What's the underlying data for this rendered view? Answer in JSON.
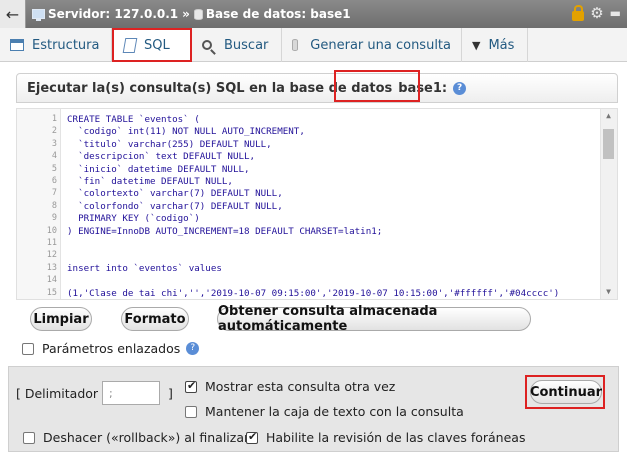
{
  "titlebar": {
    "back": "←",
    "server_label": "Servidor: 127.0.0.1",
    "separator": "»",
    "db_label": "Base de datos: base1"
  },
  "tabs": [
    {
      "label": "Estructura"
    },
    {
      "label": "SQL"
    },
    {
      "label": "Buscar"
    },
    {
      "label": "Generar una consulta"
    },
    {
      "label": "Más"
    }
  ],
  "panel": {
    "heading": "Ejecutar la(s) consulta(s) SQL en la base de datos",
    "database": "base1:",
    "help": "?"
  },
  "editor": {
    "lines": [
      {
        "n": "1",
        "text": "CREATE TABLE `eventos` ("
      },
      {
        "n": "2",
        "text": "  `codigo` int(11) NOT NULL AUTO_INCREMENT,"
      },
      {
        "n": "3",
        "text": "  `titulo` varchar(255) DEFAULT NULL,"
      },
      {
        "n": "4",
        "text": "  `descripcion` text DEFAULT NULL,"
      },
      {
        "n": "5",
        "text": "  `inicio` datetime DEFAULT NULL,"
      },
      {
        "n": "6",
        "text": "  `fin` datetime DEFAULT NULL,"
      },
      {
        "n": "7",
        "text": "  `colortexto` varchar(7) DEFAULT NULL,"
      },
      {
        "n": "8",
        "text": "  `colorfondo` varchar(7) DEFAULT NULL,"
      },
      {
        "n": "9",
        "text": "  PRIMARY KEY (`codigo`)"
      },
      {
        "n": "10",
        "text": ") ENGINE=InnoDB AUTO_INCREMENT=18 DEFAULT CHARSET=latin1;"
      },
      {
        "n": "11",
        "text": ""
      },
      {
        "n": "12",
        "text": ""
      },
      {
        "n": "13",
        "text": "insert into `eventos` values"
      },
      {
        "n": "14",
        "text": ""
      },
      {
        "n": "15",
        "text": "(1,'Clase de tai chi','','2019-10-07 09:15:00','2019-10-07 10:15:00','#ffffff','#04cccc')"
      }
    ]
  },
  "buttons": {
    "clear": "Limpiar",
    "format": "Formato",
    "stored": "Obtener consulta almacenada automáticamente"
  },
  "bound_params": {
    "label": "Parámetros enlazados",
    "checked": false
  },
  "options": {
    "delimiter_label_open": "[ Delimitador",
    "delimiter_value": ";",
    "delimiter_label_close": "]",
    "show_query": {
      "label": "Mostrar esta consulta otra vez",
      "checked": true
    },
    "keep_box": {
      "label": "Mantener la caja de texto con la consulta",
      "checked": false
    },
    "rollback": {
      "label": "Deshacer («rollback») al finalizar",
      "checked": false
    },
    "foreign_keys": {
      "label": "Habilite la revisión de las claves foráneas",
      "checked": true
    },
    "continue": "Continuar"
  },
  "colors": {
    "highlight": "#dd2222",
    "link": "#235a81",
    "titlebar": "#7a7a7a"
  }
}
